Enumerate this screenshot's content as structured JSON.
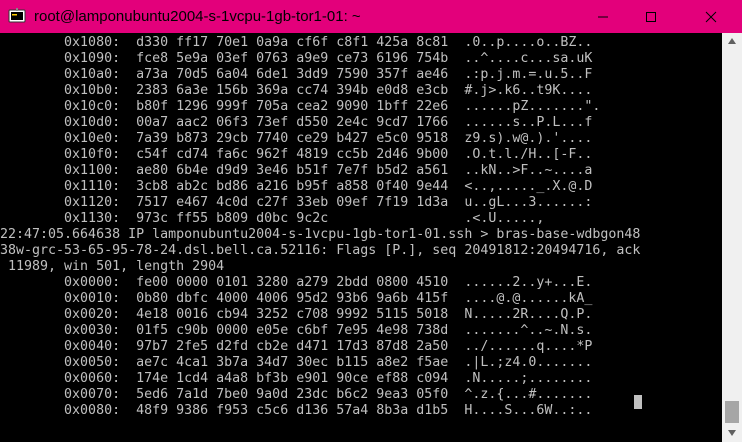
{
  "window": {
    "title": "root@lamponubuntu2004-s-1vcpu-1gb-tor1-01: ~",
    "accent_color": "#e3007b",
    "icons": {
      "app": "terminal-app-icon",
      "minimize": "minimize-icon",
      "maximize": "maximize-icon",
      "close": "close-icon"
    }
  },
  "terminal": {
    "text_color": "#c0c0c0",
    "background_color": "#000000",
    "lines": [
      "        0x1080:  d330 ff17 70e1 0a9a cf6f c8f1 425a 8c81  .0..p....o..BZ..",
      "        0x1090:  fce8 5e9a 03ef 0763 a9e9 ce73 6196 754b  ..^....c...sa.uK",
      "        0x10a0:  a73a 70d5 6a04 6de1 3dd9 7590 357f ae46  .:p.j.m.=.u.5..F",
      "        0x10b0:  2383 6a3e 156b 369a cc74 394b e0d8 e3cb  #.j>.k6..t9K....",
      "        0x10c0:  b80f 1296 999f 705a cea2 9090 1bff 22e6  ......pZ.......\".",
      "        0x10d0:  00a7 aac2 06f3 73ef d550 2e4c 9cd7 1766  ......s..P.L...f",
      "        0x10e0:  7a39 b873 29cb 7740 ce29 b427 e5c0 9518  z9.s).w@.).'....",
      "        0x10f0:  c54f cd74 fa6c 962f 4819 cc5b 2d46 9b00  .O.t.l./H..[-F..",
      "        0x1100:  ae80 6b4e d9d9 3e46 b51f 7e7f b5d2 a561  ..kN..>F..~....a",
      "        0x1110:  3cb8 ab2c bd86 a216 b95f a858 0f40 9e44  <..,....._.X.@.D",
      "        0x1120:  7517 e467 4c0d c27f 33eb 09ef 7f19 1d3a  u..gL...3......:",
      "        0x1130:  973c ff55 b809 d0bc 9c2c                 .<.U.....,",
      "22:47:05.664638 IP lamponubuntu2004-s-1vcpu-1gb-tor1-01.ssh > bras-base-wdbgon48",
      "38w-grc-53-65-95-78-24.dsl.bell.ca.52116: Flags [P.], seq 20491812:20494716, ack",
      " 11989, win 501, length 2904",
      "        0x0000:  fe00 0000 0101 3280 a279 2bdd 0800 4510  ......2..y+...E.",
      "        0x0010:  0b80 dbfc 4000 4006 95d2 93b6 9a6b 415f  ....@.@......kA_",
      "        0x0020:  4e18 0016 cb94 3252 c708 9992 5115 5018  N.....2R....Q.P.",
      "        0x0030:  01f5 c90b 0000 e05e c6bf 7e95 4e98 738d  .......^..~.N.s.",
      "        0x0040:  97b7 2fe5 d2fd cb2e d471 17d3 87d8 2a50  ../......q....*P",
      "        0x0050:  ae7c 4ca1 3b7a 34d7 30ec b115 a8e2 f5ae  .|L.;z4.0.......",
      "        0x0060:  174e 1cd4 a4a8 bf3b e901 90ce ef88 c094  .N.....;........",
      "        0x0070:  5ed6 7a1d 7be0 9a0d 23dc b6c2 9ea3 05f0  ^.z.{...#.......",
      "        0x0080:  48f9 9386 f953 c5c6 d136 57a4 8b3a d1b5  H....S...6W..:.."
    ]
  },
  "scrollbar": {
    "position_fraction": 0.98
  }
}
